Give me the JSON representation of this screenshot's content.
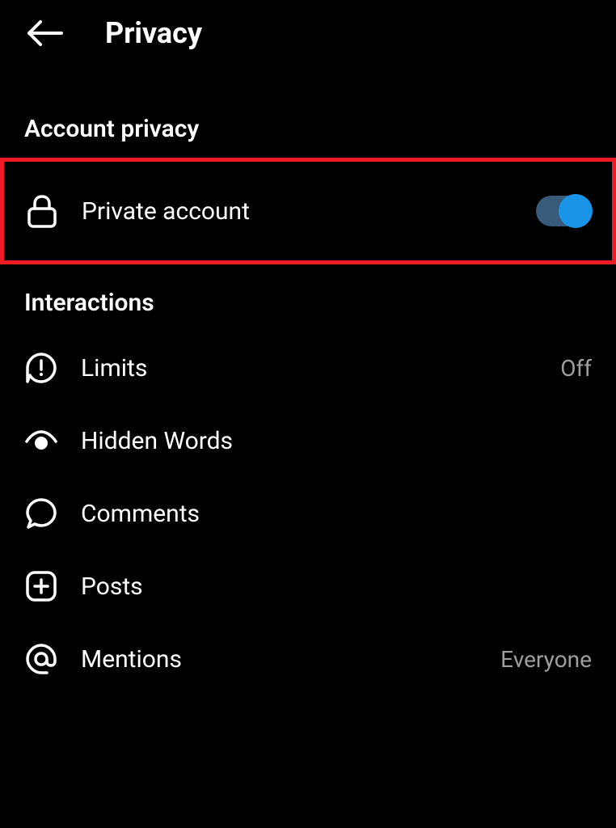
{
  "header": {
    "title": "Privacy"
  },
  "sections": {
    "account_privacy": {
      "header": "Account privacy",
      "private_account": {
        "label": "Private account",
        "enabled": true
      }
    },
    "interactions": {
      "header": "Interactions",
      "limits": {
        "label": "Limits",
        "value": "Off"
      },
      "hidden_words": {
        "label": "Hidden Words"
      },
      "comments": {
        "label": "Comments"
      },
      "posts": {
        "label": "Posts"
      },
      "mentions": {
        "label": "Mentions",
        "value": "Everyone"
      }
    }
  }
}
